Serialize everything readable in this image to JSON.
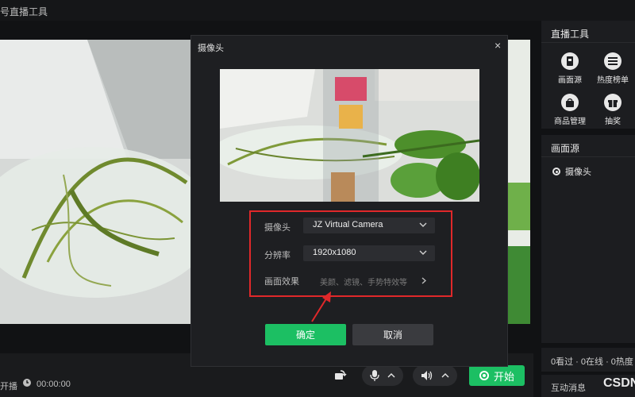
{
  "app": {
    "title": "号直播工具"
  },
  "main": {
    "stream_label": "开播",
    "elapsed": "00:00:00",
    "start_label": "开始"
  },
  "right": {
    "tools_title": "直播工具",
    "tools": [
      {
        "label": "画面源",
        "icon": "picture-source-icon"
      },
      {
        "label": "热度榜单",
        "icon": "list-icon"
      },
      {
        "label": "商品管理",
        "icon": "shopping-bag-icon"
      },
      {
        "label": "抽奖",
        "icon": "gift-icon"
      }
    ],
    "sources_title": "画面源",
    "sources": [
      {
        "label": "摄像头"
      }
    ],
    "stats": "0看过 · 0在线 · 0热度",
    "interact_title": "互动消息"
  },
  "watermark": "CSDN",
  "modal": {
    "title": "摄像头",
    "close": "×",
    "camera_label": "摄像头",
    "camera_value": "JZ Virtual Camera",
    "resolution_label": "分辨率",
    "resolution_value": "1920x1080",
    "effects_label": "画面效果",
    "effects_value": "美颜、滤镜、手势特效等",
    "ok_label": "确定",
    "cancel_label": "取消"
  },
  "colors": {
    "accent": "#1cbf63",
    "highlight": "#e0282a"
  }
}
